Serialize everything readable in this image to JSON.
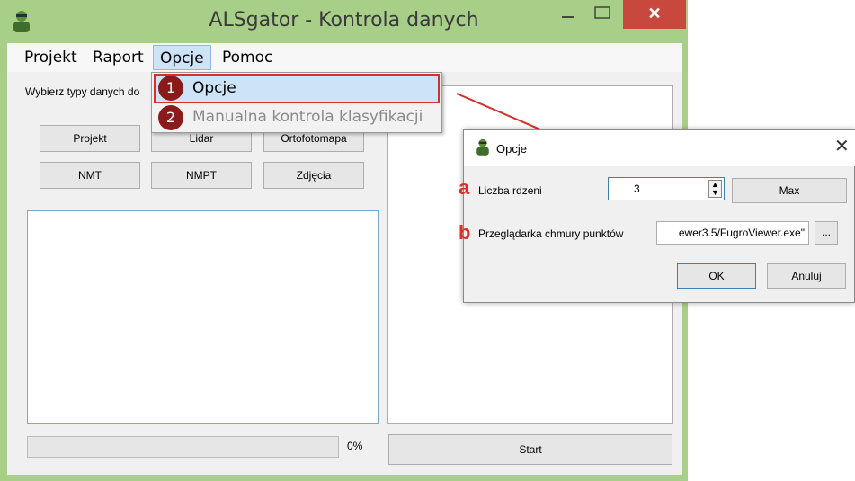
{
  "window": {
    "title": "ALSgator - Kontrola danych",
    "close_glyph": "✕"
  },
  "menubar": {
    "items": [
      "Projekt",
      "Raport",
      "Opcje",
      "Pomoc"
    ]
  },
  "main": {
    "group_label": "Wybierz typy danych do",
    "buttons": [
      "Projekt",
      "Lidar",
      "Ortofotomapa",
      "NMT",
      "NMPT",
      "Zdjęcia"
    ],
    "progress_text": "0%",
    "start_label": "Start"
  },
  "dropdown": {
    "items": [
      {
        "badge": "1",
        "label": "Opcje"
      },
      {
        "badge": "2",
        "label": "Manualna kontrola klasyfikacji"
      }
    ]
  },
  "dialog": {
    "title": "Opcje",
    "close_glyph": "✕",
    "marker_a": "a",
    "marker_b": "b",
    "cores_label": "Liczba rdzeni",
    "cores_value": "3",
    "max_label": "Max",
    "viewer_label": "Przeglądarka chmury punktów",
    "viewer_value": "ewer3.5/FugroViewer.exe\"",
    "browse_label": "...",
    "ok_label": "OK",
    "cancel_label": "Anuluj"
  },
  "colors": {
    "window_frame": "#a7cf88",
    "close_button": "#c9483e",
    "highlight_border": "#d7302a",
    "badge": "#8b1a1a"
  },
  "icons": {
    "app": "user-icon",
    "dialog": "user-icon",
    "arrow": "annotation-arrow"
  }
}
